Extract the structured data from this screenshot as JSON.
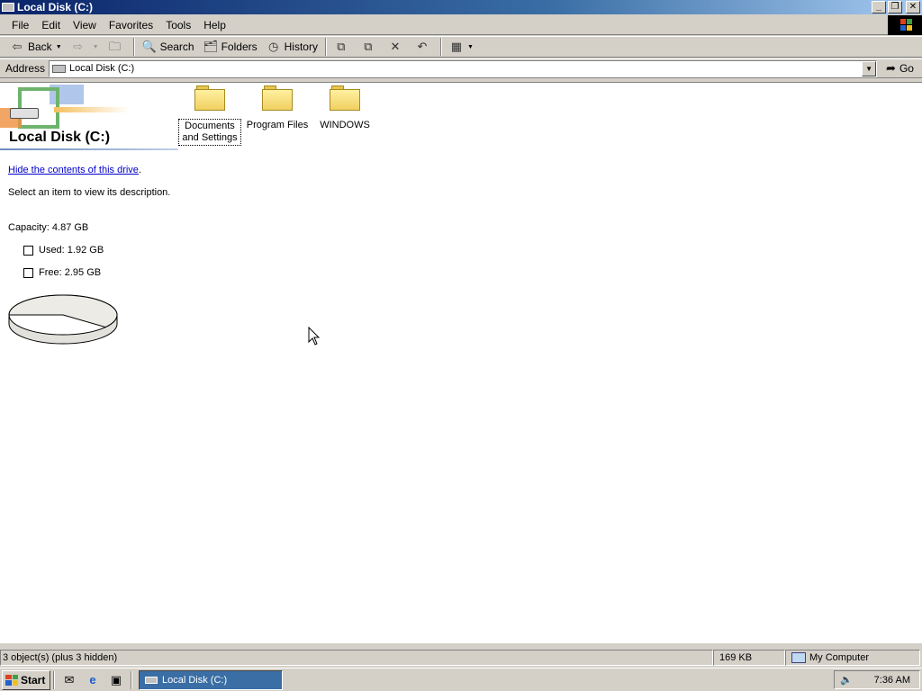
{
  "window": {
    "title": "Local Disk (C:)",
    "buttons": [
      "_",
      "❐",
      "✕"
    ]
  },
  "menu": [
    "File",
    "Edit",
    "View",
    "Favorites",
    "Tools",
    "Help"
  ],
  "toolbar": {
    "back": "Back",
    "search": "Search",
    "folders": "Folders",
    "history": "History"
  },
  "address": {
    "label": "Address",
    "value": "Local Disk (C:)",
    "go": "Go"
  },
  "panel": {
    "title": "Local Disk (C:)",
    "hide_link": "Hide the contents of this drive",
    "hide_suffix": ".",
    "description": "Select an item to view its description.",
    "capacity": "Capacity: 4.87 GB",
    "used": "Used: 1.92 GB",
    "free": "Free: 2.95 GB"
  },
  "disk_usage": {
    "used_gb": 1.92,
    "free_gb": 2.95,
    "used_color": "#ffffff",
    "free_color": "#ecebe6"
  },
  "folders": [
    {
      "label_line1": "Documents",
      "label_line2": "and Settings",
      "selected": true
    },
    {
      "label_line1": "Program Files",
      "label_line2": "",
      "selected": false
    },
    {
      "label_line1": "WINDOWS",
      "label_line2": "",
      "selected": false
    }
  ],
  "status": {
    "objects": "3 object(s) (plus 3 hidden)",
    "size": "169 KB",
    "zone": "My Computer"
  },
  "taskbar": {
    "start": "Start",
    "task": "Local Disk (C:)",
    "clock": "7:36 AM"
  },
  "colors": {
    "titlebar": "#0a246a",
    "link": "#0000cc",
    "task_active": "#3a6ea5"
  }
}
